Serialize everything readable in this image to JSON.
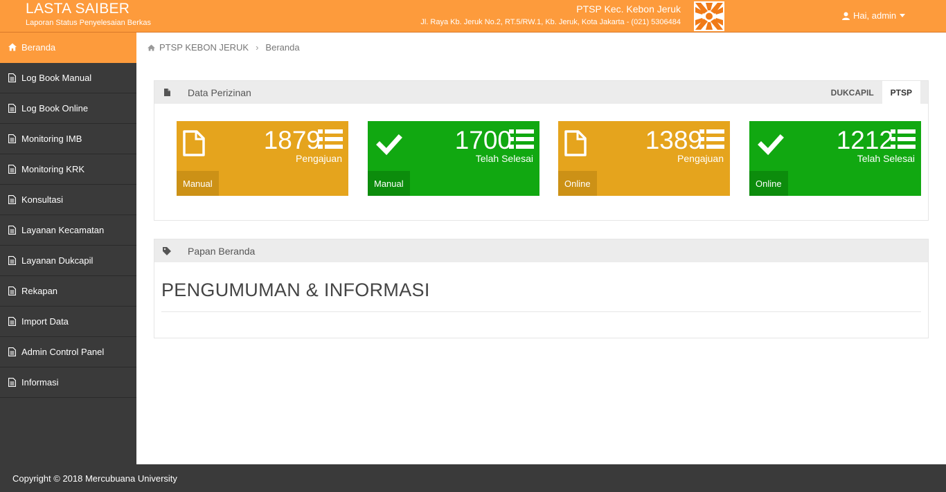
{
  "header": {
    "app_title": "LASTA SAIBER",
    "app_subtitle": "Laporan Status Penyelesaian Berkas",
    "office_name": "PTSP Kec. Kebon Jeruk",
    "office_address": "Jl. Raya Kb. Jeruk No.2, RT.5/RW.1, Kb. Jeruk, Kota Jakarta - (021) 5306484",
    "user_greeting": "Hai, admin",
    "accent_color": "#fd9b3c"
  },
  "sidebar": {
    "items": [
      {
        "label": "Beranda",
        "icon": "home-icon"
      },
      {
        "label": "Log Book Manual",
        "icon": "document-icon"
      },
      {
        "label": "Log Book Online",
        "icon": "document-icon"
      },
      {
        "label": "Monitoring IMB",
        "icon": "document-icon"
      },
      {
        "label": "Monitoring KRK",
        "icon": "document-icon"
      },
      {
        "label": "Konsultasi",
        "icon": "document-icon"
      },
      {
        "label": "Layanan Kecamatan",
        "icon": "document-icon"
      },
      {
        "label": "Layanan Dukcapil",
        "icon": "document-icon"
      },
      {
        "label": "Rekapan",
        "icon": "document-icon"
      },
      {
        "label": "Import Data",
        "icon": "document-icon"
      },
      {
        "label": "Admin Control Panel",
        "icon": "document-icon"
      },
      {
        "label": "Informasi",
        "icon": "document-icon"
      }
    ],
    "active_index": 0
  },
  "breadcrumb": {
    "root": "PTSP KEBON JERUK",
    "current": "Beranda"
  },
  "data_panel": {
    "title": "Data Perizinan",
    "tabs": [
      "DUKCAPIL",
      "PTSP"
    ],
    "active_tab": "PTSP",
    "tiles": [
      {
        "value": "1879",
        "caption": "Pengajuan",
        "tag": "Manual",
        "color": "#e5a41d",
        "icon": "file-icon"
      },
      {
        "value": "1700",
        "caption": "Telah Selesai",
        "tag": "Manual",
        "color": "#11a811",
        "icon": "check-icon"
      },
      {
        "value": "1389",
        "caption": "Pengajuan",
        "tag": "Online",
        "color": "#e5a41d",
        "icon": "file-icon"
      },
      {
        "value": "1212",
        "caption": "Telah Selesai",
        "tag": "Online",
        "color": "#11a811",
        "icon": "check-icon"
      }
    ]
  },
  "board_panel": {
    "title": "Papan Beranda",
    "heading": "PENGUMUMAN & INFORMASI"
  },
  "footer": {
    "copyright": "Copyright © 2018 Mercubuana University"
  }
}
